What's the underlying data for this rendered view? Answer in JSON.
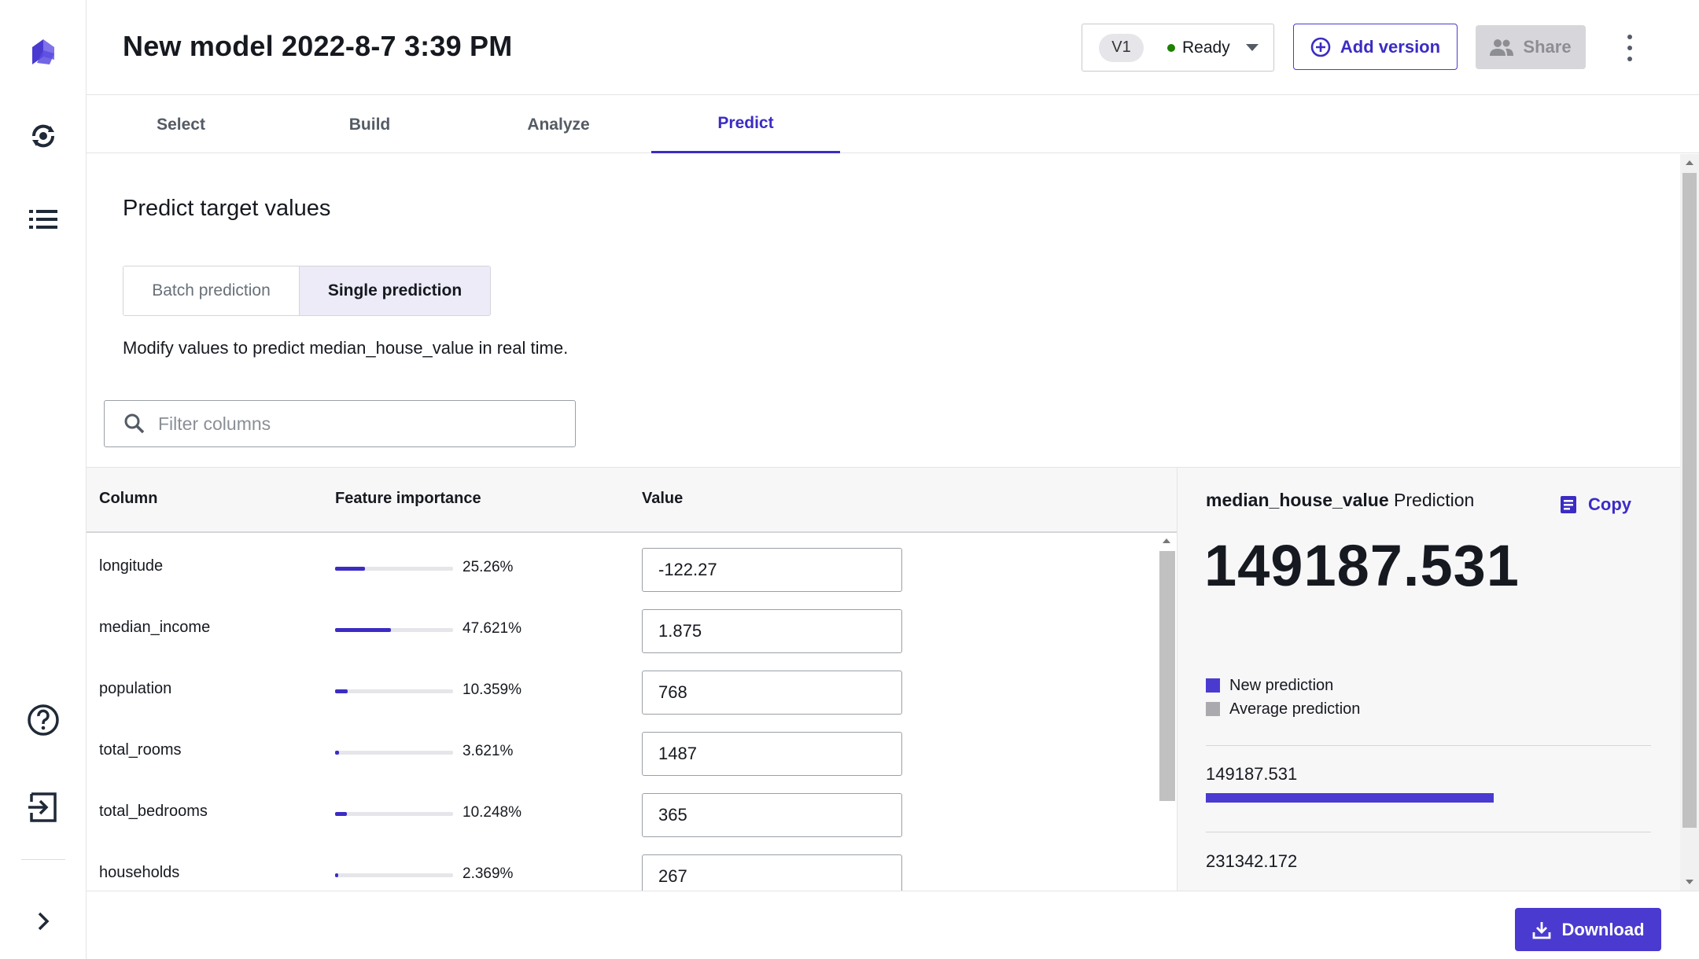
{
  "header": {
    "title": "New model 2022-8-7 3:39 PM",
    "version_label": "V1",
    "status": "Ready",
    "add_version_label": "Add version",
    "share_label": "Share"
  },
  "tabs": [
    {
      "label": "Select"
    },
    {
      "label": "Build"
    },
    {
      "label": "Analyze"
    },
    {
      "label": "Predict",
      "active": true
    }
  ],
  "main": {
    "heading": "Predict target values",
    "segments": [
      "Batch prediction",
      "Single prediction"
    ],
    "selected_segment": "Single prediction",
    "description": "Modify values to predict median_house_value in real time.",
    "filter_placeholder": "Filter columns"
  },
  "table": {
    "headers": [
      "Column",
      "Feature importance",
      "Value"
    ],
    "rows": [
      {
        "name": "longitude",
        "importance_label": "25.26%",
        "importance": 25.26,
        "value": "-122.27"
      },
      {
        "name": "median_income",
        "importance_label": "47.621%",
        "importance": 47.621,
        "value": "1.875"
      },
      {
        "name": "population",
        "importance_label": "10.359%",
        "importance": 10.359,
        "value": "768"
      },
      {
        "name": "total_rooms",
        "importance_label": "3.621%",
        "importance": 3.621,
        "value": "1487"
      },
      {
        "name": "total_bedrooms",
        "importance_label": "10.248%",
        "importance": 10.248,
        "value": "365"
      },
      {
        "name": "households",
        "importance_label": "2.369%",
        "importance": 2.369,
        "value": "267"
      }
    ]
  },
  "prediction": {
    "target": "median_house_value",
    "suffix": "Prediction",
    "copy_label": "Copy",
    "value": "149187.531",
    "legend_new": "New prediction",
    "legend_avg": "Average prediction",
    "new_value_label": "149187.531",
    "new_value": 149187.531,
    "avg_value_label": "231342.172",
    "avg_value": 231342.172
  },
  "footer": {
    "download_label": "Download"
  },
  "colors": {
    "accent": "#3b2cc4",
    "status_ready": "#1d8102",
    "average_gray": "#a9a9ae"
  },
  "icons": [
    "app-logo-icon",
    "models-icon",
    "list-icon",
    "help-icon",
    "sign-out-icon",
    "expand-chevron-icon",
    "plus-circle-icon",
    "users-icon",
    "kebab-icon",
    "search-icon",
    "copy-icon",
    "download-icon"
  ]
}
